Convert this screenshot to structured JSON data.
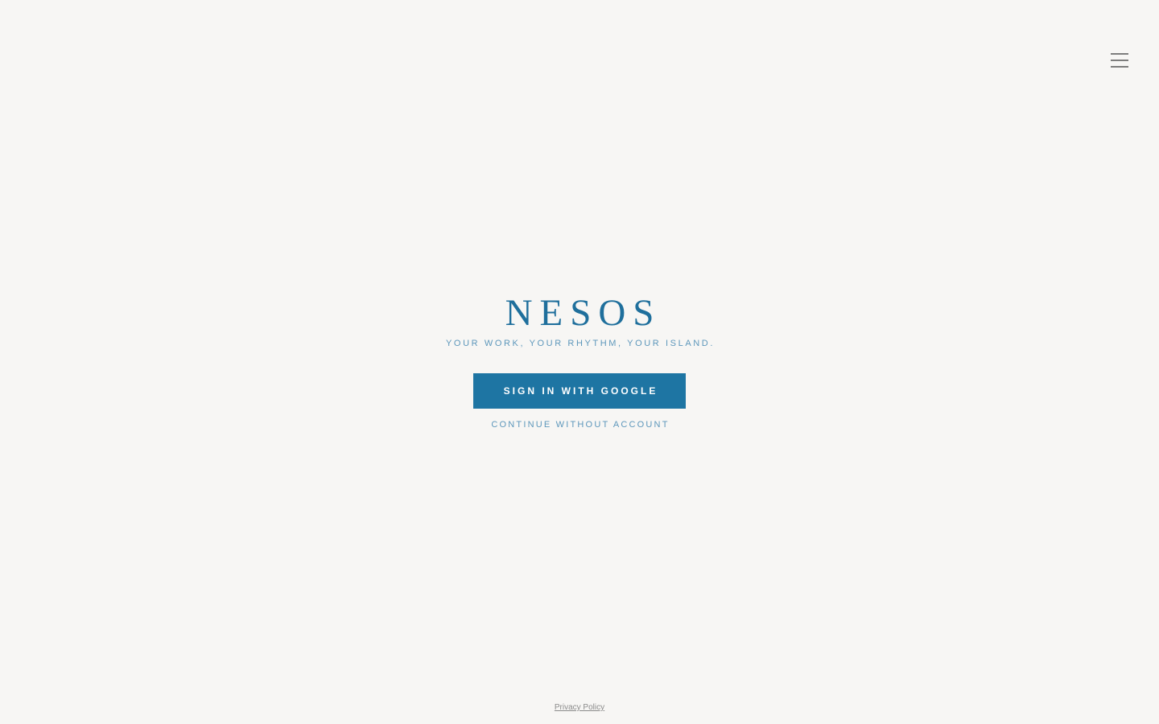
{
  "header": {
    "menu_icon": "hamburger-menu-icon"
  },
  "brand": {
    "name": "NESOS",
    "tagline": "YOUR WORK, YOUR RHYTHM, YOUR ISLAND."
  },
  "actions": {
    "google_signin_label": "SIGN IN WITH GOOGLE",
    "continue_label": "CONTINUE WITHOUT ACCOUNT"
  },
  "footer": {
    "privacy_label": "Privacy Policy"
  },
  "colors": {
    "background": "#f7f6f4",
    "brand": "#1f6f9c",
    "button": "#1e75a3",
    "muted_link": "#5d97bb"
  }
}
